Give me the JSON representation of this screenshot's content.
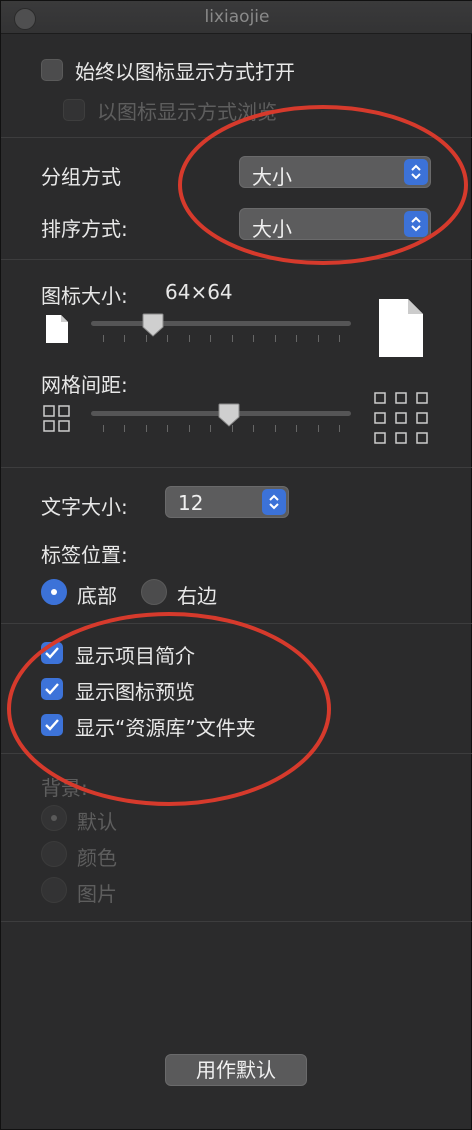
{
  "window": {
    "title": "lixiaojie"
  },
  "general": {
    "always_open_icon_view": "始终以图标显示方式打开",
    "browse_icon_view": "以图标显示方式浏览"
  },
  "arrange": {
    "group_label": "分组方式",
    "group_value": "大小",
    "sort_label": "排序方式:",
    "sort_value": "大小"
  },
  "icon_size": {
    "label": "图标大小:",
    "value": "64×64",
    "slider_fraction": 0.24
  },
  "grid_spacing": {
    "label": "网格间距:",
    "slider_fraction": 0.53
  },
  "text": {
    "size_label": "文字大小:",
    "size_value": "12",
    "label_position": "标签位置:",
    "bottom": "底部",
    "right": "右边"
  },
  "show": {
    "item_info": "显示项目简介",
    "icon_preview": "显示图标预览",
    "library_folder": "显示“资源库”文件夹"
  },
  "background": {
    "label": "背景:",
    "default": "默认",
    "color": "颜色",
    "picture": "图片"
  },
  "actions": {
    "use_as_defaults": "用作默认"
  },
  "colors": {
    "accent": "#3c72d8",
    "annotation": "#d63a2c"
  }
}
